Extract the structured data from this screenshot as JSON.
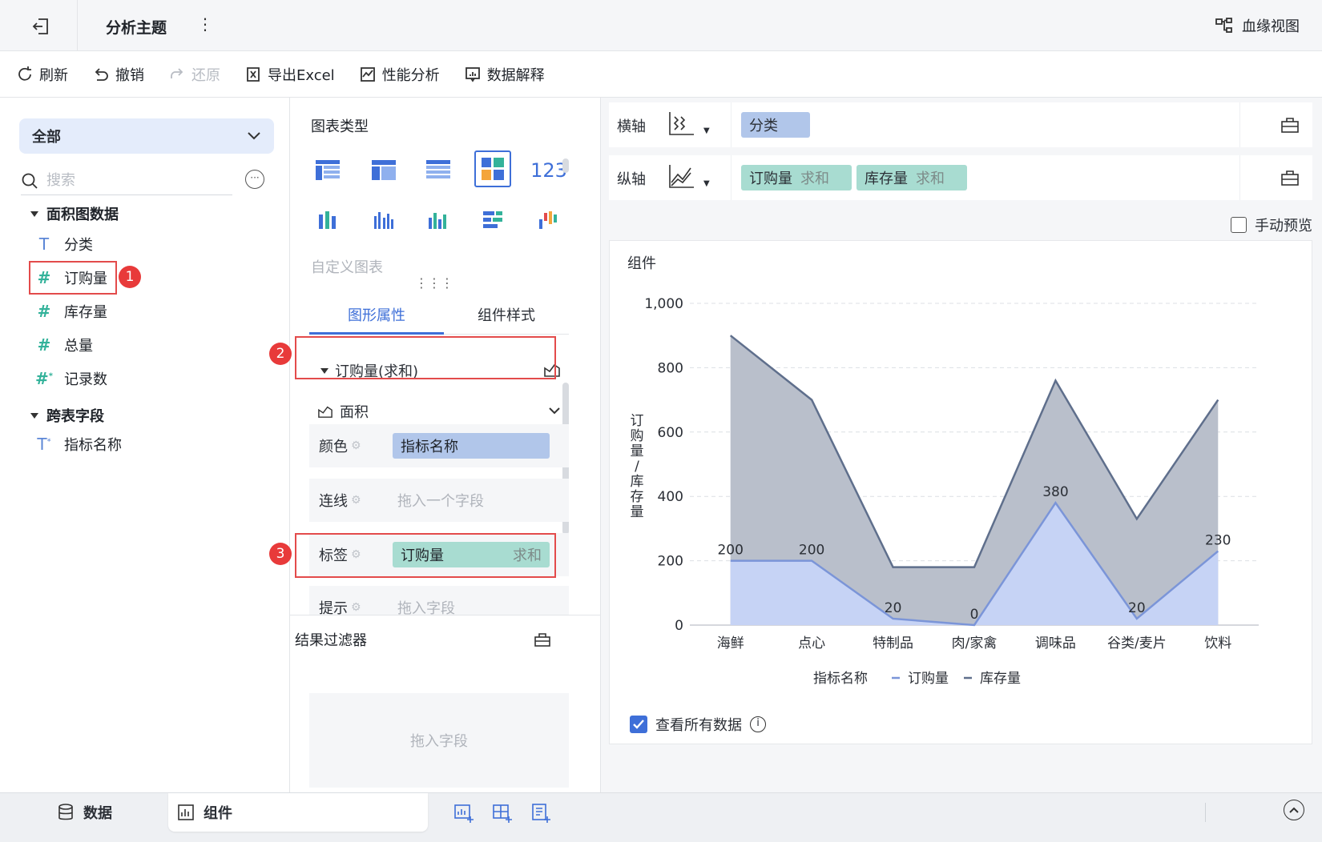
{
  "header": {
    "title": "分析主题",
    "lineage_label": "血缘视图"
  },
  "toolbar": {
    "refresh": "刷新",
    "undo": "撤销",
    "redo": "还原",
    "export_excel": "导出Excel",
    "performance": "性能分析",
    "explain": "数据解释"
  },
  "left": {
    "dataset_select": "全部",
    "search_placeholder": "搜索",
    "groups": [
      {
        "title": "面积图数据",
        "fields": [
          {
            "type": "text",
            "label": "分类"
          },
          {
            "type": "number",
            "label": "订购量"
          },
          {
            "type": "number",
            "label": "库存量"
          },
          {
            "type": "number",
            "label": "总量"
          },
          {
            "type": "number-calc",
            "label": "记录数"
          }
        ]
      },
      {
        "title": "跨表字段",
        "fields": [
          {
            "type": "text-calc",
            "label": "指标名称"
          }
        ]
      }
    ],
    "badges": [
      "1",
      "2",
      "3"
    ]
  },
  "mid": {
    "chart_type_title": "图表类型",
    "number_icon": "123",
    "custom_chart": "自定义图表",
    "tabs": [
      "图形属性",
      "组件样式"
    ],
    "measure_head": "订购量(求和)",
    "mark_type": "面积",
    "props": {
      "color_label": "颜色",
      "color_value": "指标名称",
      "line_label": "连线",
      "line_placeholder": "拖入一个字段",
      "label_label": "标签",
      "label_value": "订购量",
      "label_agg": "求和",
      "tip_label": "提示",
      "tip_placeholder": "拖入字段"
    },
    "filter_title": "结果过滤器",
    "filter_placeholder": "拖入字段"
  },
  "right": {
    "x_axis_label": "横轴",
    "y_axis_label": "纵轴",
    "x_pill": "分类",
    "y_pills": [
      {
        "name": "订购量",
        "agg": "求和"
      },
      {
        "name": "库存量",
        "agg": "求和"
      }
    ],
    "manual_preview": "手动预览",
    "view_all": "查看所有数据"
  },
  "chart_data": {
    "type": "area",
    "title": "组件",
    "ylabel": "订购量/库存量",
    "xlabel": "",
    "categories": [
      "海鲜",
      "点心",
      "特制品",
      "肉/家禽",
      "调味品",
      "谷类/麦片",
      "饮料"
    ],
    "ylim": [
      0,
      1000
    ],
    "yticks": [
      "0",
      "200",
      "400",
      "600",
      "800",
      "1,000"
    ],
    "legend_title": "指标名称",
    "series": [
      {
        "name": "订购量",
        "values": [
          200,
          200,
          20,
          0,
          380,
          20,
          230
        ],
        "color": "#7b95d8",
        "fill": "#c6d3f5",
        "labels": true
      },
      {
        "name": "库存量",
        "values": [
          900,
          700,
          180,
          180,
          760,
          330,
          700
        ],
        "color": "#5f6f8c",
        "fill": "#b9bfcb",
        "labels": false
      }
    ],
    "grid": true,
    "legend_position": "bottom"
  },
  "bottom": {
    "data_tab": "数据",
    "component_tab": "组件"
  },
  "colors": {
    "accent": "#3e6fd8",
    "highlight": "#e34b4b"
  }
}
